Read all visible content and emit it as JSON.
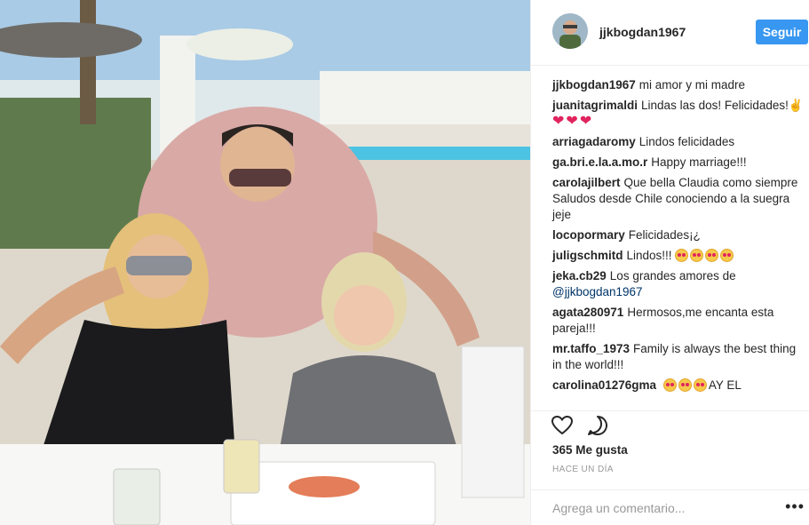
{
  "post": {
    "username": "jjkbogdan1967",
    "follow_label": "Seguir",
    "likes": "365 Me gusta",
    "time": "HACE UN DÍA",
    "comment_placeholder": "Agrega un comentario...",
    "more_label": "•••"
  },
  "comments": [
    {
      "user": "jjkbogdan1967",
      "text": "mi amor y mi madre"
    },
    {
      "user": "juanitagrimaldi",
      "text": "Lindas las dos! Felicidades!✌",
      "hearts": 3
    },
    {
      "user": "arriagadaromy",
      "text": "Lindos felicidades"
    },
    {
      "user": "ga.bri.e.la.a.mo.r",
      "text": "Happy marriage!!!"
    },
    {
      "user": "carolajilbert",
      "text": "Que bella Claudia como siempre Saludos desde Chile conociendo a la suegra jeje"
    },
    {
      "user": "locopormary",
      "text": "Felicidades¡¿"
    },
    {
      "user": "juligschmitd",
      "text": "Lindos!!!",
      "faces": 4
    },
    {
      "user": "jeka.cb29",
      "text": "Los grandes amores de",
      "mention": "@jjkbogdan1967"
    },
    {
      "user": "agata280971",
      "text": "Hermosos,me encanta esta pareja!!!"
    },
    {
      "user": "mr.taffo_1973",
      "text": "Family is always the best thing in the world!!!"
    },
    {
      "user": "carolina01276gma",
      "text": "AY EL",
      "faces_before": 3
    }
  ],
  "icons": {
    "like": "heart-icon",
    "comment": "comment-icon"
  }
}
